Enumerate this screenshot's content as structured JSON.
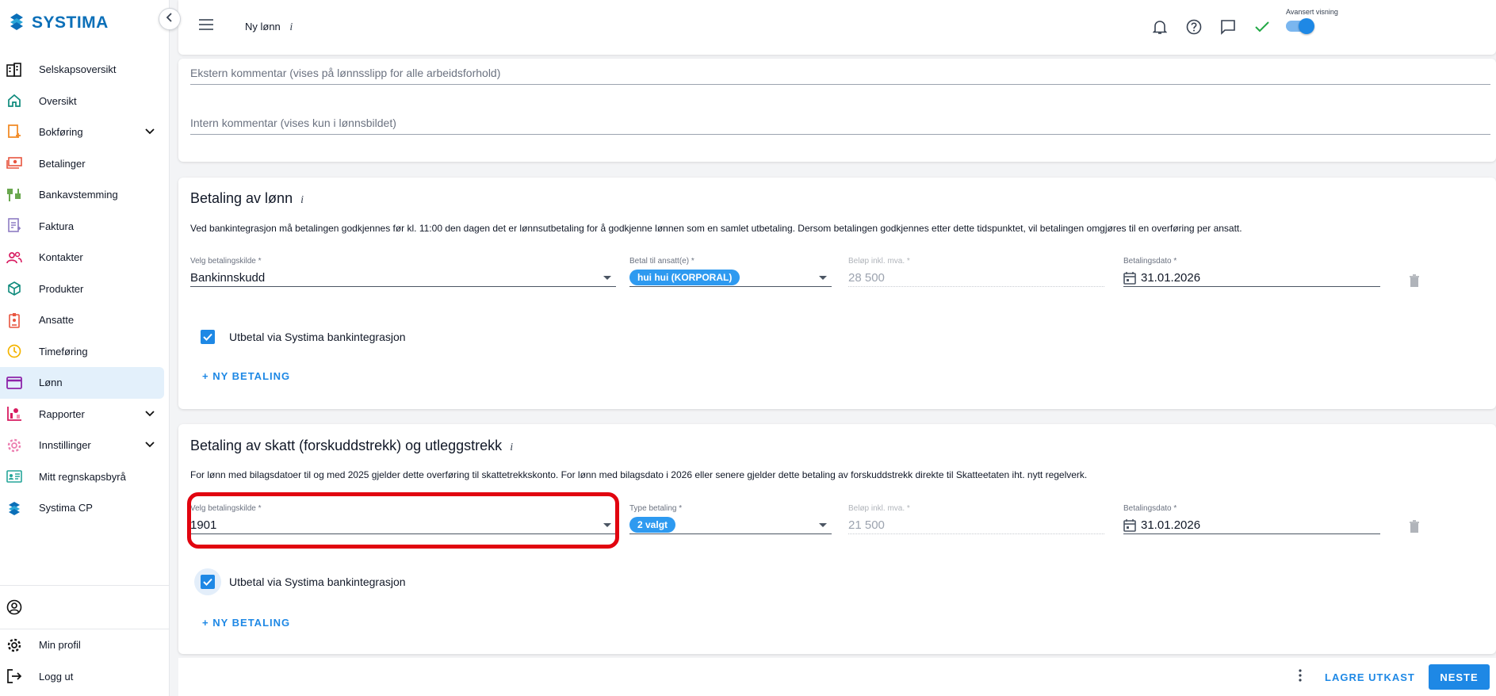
{
  "brand": {
    "name": "SYSTIMA"
  },
  "sidebar": {
    "items": [
      {
        "label": "Selskapsoversikt",
        "icon": "building-icon"
      },
      {
        "label": "Oversikt",
        "icon": "home-icon"
      },
      {
        "label": "Bokføring",
        "icon": "bookkeeping-icon",
        "expandable": true
      },
      {
        "label": "Betalinger",
        "icon": "payments-icon"
      },
      {
        "label": "Bankavstemming",
        "icon": "bank-reconciliation-icon"
      },
      {
        "label": "Faktura",
        "icon": "invoice-icon"
      },
      {
        "label": "Kontakter",
        "icon": "contacts-icon"
      },
      {
        "label": "Produkter",
        "icon": "products-icon"
      },
      {
        "label": "Ansatte",
        "icon": "employees-icon"
      },
      {
        "label": "Timeføring",
        "icon": "clock-icon"
      },
      {
        "label": "Lønn",
        "icon": "salary-icon",
        "active": true
      },
      {
        "label": "Rapporter",
        "icon": "reports-icon",
        "expandable": true
      },
      {
        "label": "Innstillinger",
        "icon": "settings-icon",
        "expandable": true
      },
      {
        "label": "Mitt regnskapsbyrå",
        "icon": "accounting-firm-icon"
      },
      {
        "label": "Systima CP",
        "icon": "systima-cp-icon"
      }
    ],
    "bottom": {
      "profile_label": "",
      "my_profile": "Min profil",
      "logout": "Logg ut"
    }
  },
  "header": {
    "title": "Ny lønn",
    "info": "i",
    "advanced_view_label": "Avansert visning",
    "advanced_view_on": true,
    "user_name": ""
  },
  "comments": {
    "external_placeholder": "Ekstern kommentar (vises på lønnsslipp for alle arbeidsforhold)",
    "internal_placeholder": "Intern kommentar (vises kun i lønnsbildet)"
  },
  "salary_payment": {
    "title": "Betaling av lønn",
    "info": "i",
    "description": "Ved bankintegrasjon må betalingen godkjennes før kl. 11:00 den dagen det er lønnsutbetaling for å godkjenne lønnen som en samlet utbetaling. Dersom betalingen godkjennes etter dette tidspunktet, vil betalingen omgjøres til en overføring per ansatt.",
    "source_label": "Velg betalingskilde *",
    "source_value": "Bankinnskudd",
    "payee_label": "Betal til ansatt(e) *",
    "payee_chip": "hui hui (KORPORAL)",
    "amount_label": "Beløp inkl. mva. *",
    "amount_value": "28 500",
    "date_label": "Betalingsdato *",
    "date_value": "31.01.2026",
    "bank_integration_label": "Utbetal via Systima bankintegrasjon",
    "bank_integration_checked": true,
    "new_payment": "+ NY BETALING"
  },
  "tax_payment": {
    "title": "Betaling av skatt (forskuddstrekk) og utleggstrekk",
    "info": "i",
    "description": "For lønn med bilagsdatoer til og med 2025 gjelder dette overføring til skattetrekkskonto. For lønn med bilagsdato i 2026 eller senere gjelder dette betaling av forskuddstrekk direkte til Skatteetaten iht. nytt regelverk.",
    "source_label": "Velg betalingskilde *",
    "source_value": "1901",
    "type_label": "Type betaling *",
    "type_chip": "2 valgt",
    "amount_label": "Beløp inkl. mva. *",
    "amount_value": "21 500",
    "date_label": "Betalingsdato *",
    "date_value": "31.01.2026",
    "bank_integration_label": "Utbetal via Systima bankintegrasjon",
    "bank_integration_checked": true,
    "new_payment": "+ NY BETALING"
  },
  "actions": {
    "save_draft": "LAGRE UTKAST",
    "next": "NESTE"
  },
  "colors": {
    "primary": "#1e88e5",
    "highlight": "#e1040f",
    "active_nav": "#e3f0fb"
  }
}
